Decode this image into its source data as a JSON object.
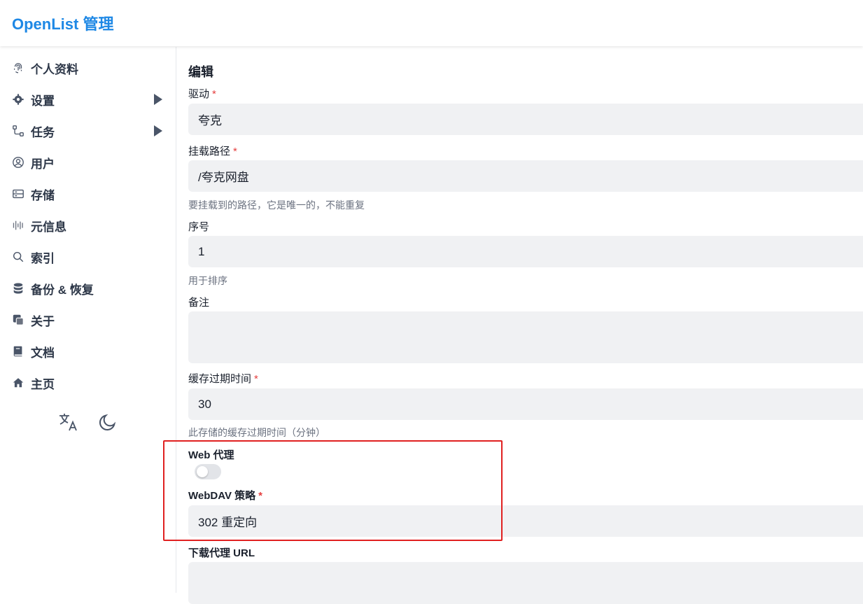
{
  "header": {
    "title": "OpenList 管理"
  },
  "sidebar": {
    "items": [
      {
        "label": "个人资料",
        "icon": "fingerprint-icon",
        "has_arrow": false
      },
      {
        "label": "设置",
        "icon": "gear-icon",
        "has_arrow": true
      },
      {
        "label": "任务",
        "icon": "workflow-icon",
        "has_arrow": true
      },
      {
        "label": "用户",
        "icon": "user-circle-icon",
        "has_arrow": false
      },
      {
        "label": "存储",
        "icon": "storage-icon",
        "has_arrow": false
      },
      {
        "label": "元信息",
        "icon": "metadata-icon",
        "has_arrow": false
      },
      {
        "label": "索引",
        "icon": "search-icon",
        "has_arrow": false
      },
      {
        "label": "备份 & 恢复",
        "icon": "database-icon",
        "has_arrow": false
      },
      {
        "label": "关于",
        "icon": "copy-icon",
        "has_arrow": false
      },
      {
        "label": "文档",
        "icon": "book-icon",
        "has_arrow": false
      },
      {
        "label": "主页",
        "icon": "home-icon",
        "has_arrow": false
      }
    ],
    "bottom": {
      "language_icon": "translate-icon",
      "theme_icon": "moon-icon"
    }
  },
  "form": {
    "section_title": "编辑",
    "driver": {
      "label": "驱动",
      "required": "*",
      "value": "夸克"
    },
    "mount_path": {
      "label": "挂载路径",
      "required": "*",
      "value": "/夸克网盘",
      "help": "要挂载到的路径，它是唯一的，不能重复"
    },
    "order": {
      "label": "序号",
      "value": "1",
      "help": "用于排序"
    },
    "remark": {
      "label": "备注",
      "value": ""
    },
    "cache_expiration": {
      "label": "缓存过期时间",
      "required": "*",
      "value": "30",
      "help": "此存储的缓存过期时间（分钟）"
    },
    "web_proxy": {
      "label": "Web 代理",
      "enabled": false
    },
    "webdav_policy": {
      "label": "WebDAV 策略",
      "required": "*",
      "value": "302 重定向"
    },
    "download_proxy_url": {
      "label": "下载代理 URL",
      "value": ""
    }
  },
  "annotation": {
    "color": "#e02020"
  }
}
